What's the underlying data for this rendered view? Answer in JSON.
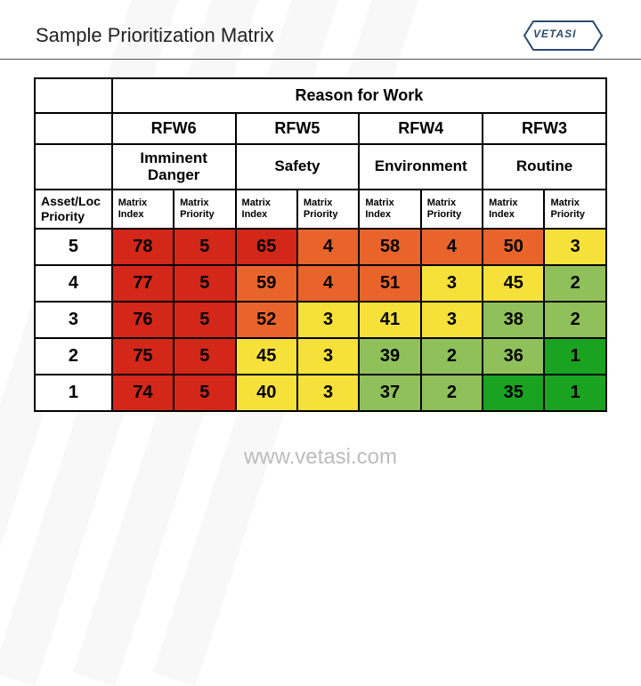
{
  "title": "Sample Prioritization Matrix",
  "logo_text": "VETASI",
  "footer_url": "www.vetasi.com",
  "table": {
    "reason_header": "Reason for Work",
    "asset_header": "Asset/Loc Priority",
    "sub_index": "Matrix Index",
    "sub_priority": "Matrix Priority",
    "columns": [
      {
        "code": "RFW6",
        "reason": "Imminent Danger"
      },
      {
        "code": "RFW5",
        "reason": "Safety"
      },
      {
        "code": "RFW4",
        "reason": "Environment"
      },
      {
        "code": "RFW3",
        "reason": "Routine"
      }
    ],
    "rows": [
      {
        "label": "5",
        "cells": [
          {
            "idx": "78",
            "pri": "5",
            "ic": "#d22719",
            "pc": "#d22719"
          },
          {
            "idx": "65",
            "pri": "4",
            "ic": "#d22719",
            "pc": "#e9642b"
          },
          {
            "idx": "58",
            "pri": "4",
            "ic": "#e9642b",
            "pc": "#e9642b"
          },
          {
            "idx": "50",
            "pri": "3",
            "ic": "#e9642b",
            "pc": "#f6e03a"
          }
        ]
      },
      {
        "label": "4",
        "cells": [
          {
            "idx": "77",
            "pri": "5",
            "ic": "#d22719",
            "pc": "#d22719"
          },
          {
            "idx": "59",
            "pri": "4",
            "ic": "#e9642b",
            "pc": "#e9642b"
          },
          {
            "idx": "51",
            "pri": "3",
            "ic": "#e9642b",
            "pc": "#f6e03a"
          },
          {
            "idx": "45",
            "pri": "2",
            "ic": "#f6e03a",
            "pc": "#8fc05a"
          }
        ]
      },
      {
        "label": "3",
        "cells": [
          {
            "idx": "76",
            "pri": "5",
            "ic": "#d22719",
            "pc": "#d22719"
          },
          {
            "idx": "52",
            "pri": "3",
            "ic": "#e9642b",
            "pc": "#f6e03a"
          },
          {
            "idx": "41",
            "pri": "3",
            "ic": "#f6e03a",
            "pc": "#f6e03a"
          },
          {
            "idx": "38",
            "pri": "2",
            "ic": "#8fc05a",
            "pc": "#8fc05a"
          }
        ]
      },
      {
        "label": "2",
        "cells": [
          {
            "idx": "75",
            "pri": "5",
            "ic": "#d22719",
            "pc": "#d22719"
          },
          {
            "idx": "45",
            "pri": "3",
            "ic": "#f6e03a",
            "pc": "#f6e03a"
          },
          {
            "idx": "39",
            "pri": "2",
            "ic": "#8fc05a",
            "pc": "#8fc05a"
          },
          {
            "idx": "36",
            "pri": "1",
            "ic": "#8fc05a",
            "pc": "#1aa321"
          }
        ]
      },
      {
        "label": "1",
        "cells": [
          {
            "idx": "74",
            "pri": "5",
            "ic": "#d22719",
            "pc": "#d22719"
          },
          {
            "idx": "40",
            "pri": "3",
            "ic": "#f6e03a",
            "pc": "#f6e03a"
          },
          {
            "idx": "37",
            "pri": "2",
            "ic": "#8fc05a",
            "pc": "#8fc05a"
          },
          {
            "idx": "35",
            "pri": "1",
            "ic": "#1aa321",
            "pc": "#1aa321"
          }
        ]
      }
    ]
  },
  "chart_data": {
    "type": "table",
    "title": "Sample Prioritization Matrix",
    "row_axis": "Asset/Loc Priority",
    "col_axis": "Reason for Work",
    "row_labels": [
      5,
      4,
      3,
      2,
      1
    ],
    "col_labels": [
      "RFW6 Imminent Danger",
      "RFW5 Safety",
      "RFW4 Environment",
      "RFW3 Routine"
    ],
    "matrix_index": [
      [
        78,
        65,
        58,
        50
      ],
      [
        77,
        59,
        51,
        45
      ],
      [
        76,
        52,
        41,
        38
      ],
      [
        75,
        45,
        39,
        36
      ],
      [
        74,
        40,
        37,
        35
      ]
    ],
    "matrix_priority": [
      [
        5,
        4,
        4,
        3
      ],
      [
        5,
        4,
        3,
        2
      ],
      [
        5,
        3,
        3,
        2
      ],
      [
        5,
        3,
        2,
        1
      ],
      [
        5,
        3,
        2,
        1
      ]
    ]
  }
}
